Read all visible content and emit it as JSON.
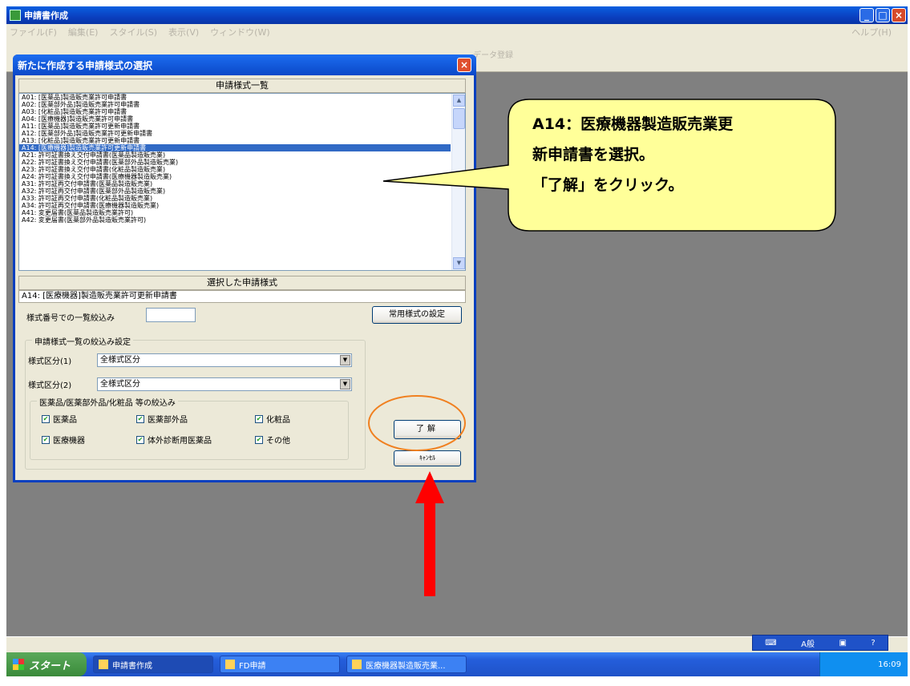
{
  "app": {
    "title": "申請書作成",
    "menu": [
      "ファイル(F)",
      "編集(E)",
      "スタイル(S)",
      "表示(V)",
      "ウィンドウ(W)"
    ],
    "help": "ヘルプ(H)",
    "toolbar_data_button": "データ登録"
  },
  "dialog": {
    "title": "新たに作成する申請様式の選択",
    "list_header": "申請様式一覧",
    "list_items": [
      "A01: [医薬品]製造販売業許可申請書",
      "A02: [医薬部外品]製造販売業許可申請書",
      "A03: [化粧品]製造販売業許可申請書",
      "A04: [医療機器]製造販売業許可申請書",
      "A11: [医薬品]製造販売業許可更新申請書",
      "A12: [医薬部外品]製造販売業許可更新申請書",
      "A13: [化粧品]製造販売業許可更新申請書",
      "A14: [医療機器]製造販売業許可更新申請書",
      "A21: 許可証書換え交付申請書(医薬品製造販売業)",
      "A22: 許可証書換え交付申請書(医薬部外品製造販売業)",
      "A23: 許可証書換え交付申請書(化粧品製造販売業)",
      "A24: 許可証書換え交付申請書(医療機器製造販売業)",
      "A31: 許可証再交付申請書(医薬品製造販売業)",
      "A32: 許可証再交付申請書(医薬部外品製造販売業)",
      "A33: 許可証再交付申請書(化粧品製造販売業)",
      "A34: 許可証再交付申請書(医療機器製造販売業)",
      "A41: 変更届書(医薬品製造販売業許可)",
      "A42: 変更届書(医薬部外品製造販売業許可)"
    ],
    "selected_index": 7,
    "selected_header": "選択した申請様式",
    "selected_value": "A14: [医療機器]製造販売業許可更新申請書",
    "filter_label": "様式番号での一覧絞込み",
    "filter_value": "",
    "common_button": "常用様式の設定",
    "group_filter_title": "申請様式一覧の絞込み設定",
    "type1_label": "様式区分(1)",
    "type1_value": "全様式区分",
    "type2_label": "様式区分(2)",
    "type2_value": "全様式区分",
    "group_product_title": "医薬品/医薬部外品/化粧品 等の絞込み",
    "checkboxes": {
      "drug": "医薬品",
      "quasi": "医薬部外品",
      "cosmetic": "化粧品",
      "device": "医療機器",
      "diag": "体外診断用医薬品",
      "other": "その他"
    },
    "ok_button": "了解",
    "cancel_button": "ｷｬﾝｾﾙ"
  },
  "callout": {
    "line1": "A14：医療機器製造販売業更",
    "line2": "新申請書を選択。",
    "line3": "「了解」をクリック。"
  },
  "taskbar": {
    "start": "スタート",
    "tasks": [
      "申請書作成",
      "FD申請",
      "医療機器製造販売業..."
    ],
    "clock": "16:09",
    "ime": "A般"
  },
  "colors": {
    "callout_fill": "#ffff99",
    "highlight_ellipse": "#f08020",
    "arrow": "#ff0000",
    "selection": "#316ac5"
  }
}
